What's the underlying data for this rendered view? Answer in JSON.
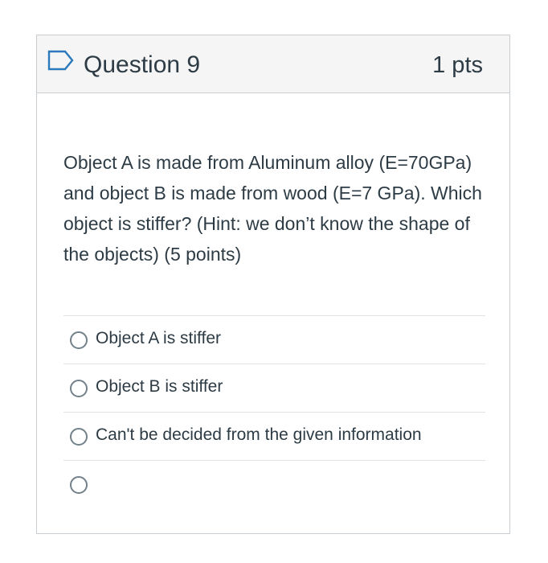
{
  "question": {
    "title": "Question 9",
    "points": "1 pts",
    "flag_icon": "flag-outline-icon",
    "text": "Object A is made from Aluminum alloy (E=70GPa) and object B is made from wood (E=7 GPa). Which object is stiffer? (Hint: we don’t know the shape of the objects) (5 points)"
  },
  "answers": [
    {
      "label": "Object A is stiffer",
      "selected": false
    },
    {
      "label": "Object B is stiffer",
      "selected": false
    },
    {
      "label": "Can't be decided from the given information",
      "selected": false
    },
    {
      "label": "",
      "selected": false
    }
  ],
  "colors": {
    "header_bg": "#f5f5f5",
    "border": "#c7cdd1",
    "text": "#2d3b45",
    "radio_border": "#73818a"
  }
}
